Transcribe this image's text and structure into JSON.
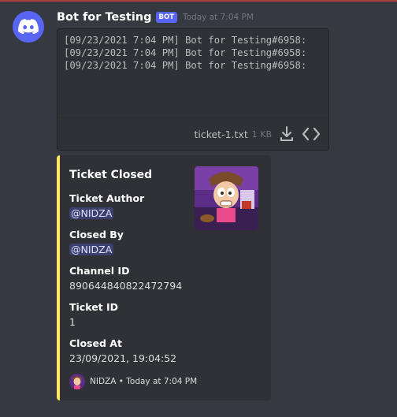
{
  "message": {
    "username": "Bot for Testing",
    "bot_tag": "BOT",
    "timestamp": "Today at 7:04 PM"
  },
  "attachment": {
    "lines": [
      "[09/23/2021 7:04 PM] Bot for Testing#6958:",
      "[09/23/2021 7:04 PM] Bot for Testing#6958:",
      "[09/23/2021 7:04 PM] Bot for Testing#6958:"
    ],
    "file_name": "ticket-1.txt",
    "file_size": "1 KB"
  },
  "embed": {
    "accent_color": "#fee75c",
    "title": "Ticket Closed",
    "fields": [
      {
        "name": "Ticket Author",
        "value": "@NIDZA",
        "mention": true
      },
      {
        "name": "Closed By",
        "value": "@NIDZA",
        "mention": true
      },
      {
        "name": "Channel ID",
        "value": "890644840822472794",
        "mention": false
      },
      {
        "name": "Ticket ID",
        "value": "1",
        "mention": false
      },
      {
        "name": "Closed At",
        "value": "23/09/2021, 19:04:52",
        "mention": false
      }
    ],
    "footer": "NIDZA • Today at 7:04 PM"
  },
  "icons": {
    "avatar": "discord-logo-icon",
    "download": "download-icon",
    "code": "code-icon"
  }
}
